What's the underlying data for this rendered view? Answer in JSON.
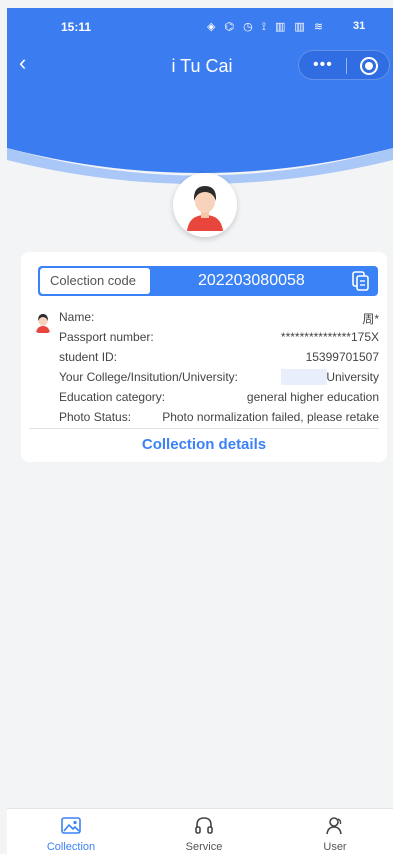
{
  "status_bar": {
    "time": "15:11",
    "icons": "◈ ⌬ ◷ ⟟ ▥ ▥ ≋",
    "battery": "31"
  },
  "nav": {
    "title": "i Tu Cai",
    "back": "‹",
    "more": "•••"
  },
  "card": {
    "code_label": "Colection code",
    "code_value": "202203080058",
    "rows": [
      {
        "label": "Name:",
        "value": "周*"
      },
      {
        "label": "Passport number:",
        "value": "***************175X"
      },
      {
        "label": "student ID:",
        "value": "15399701507"
      },
      {
        "label": "Your College/Insitution/University:",
        "value": "University"
      },
      {
        "label": "Education category:",
        "value": "general higher education"
      },
      {
        "label": "Photo Status:",
        "value": "Photo normalization failed, please retake"
      }
    ],
    "details_link": "Collection details"
  },
  "tabs": [
    {
      "label": "Collection",
      "icon": "image-icon",
      "active": true
    },
    {
      "label": "Service",
      "icon": "headset-icon",
      "active": false
    },
    {
      "label": "User",
      "icon": "user-icon",
      "active": false
    }
  ],
  "colors": {
    "primary": "#3b82f6",
    "background": "#f3f4f6"
  }
}
